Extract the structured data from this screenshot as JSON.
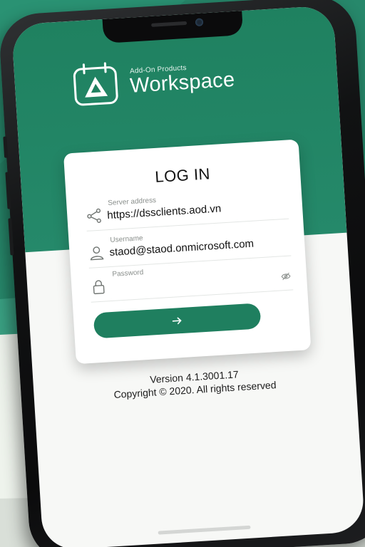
{
  "app": {
    "brand_subtitle": "Add-On Products",
    "brand_title": "Workspace",
    "logo_icon": "calendar-a-icon"
  },
  "login": {
    "title": "LOG IN",
    "server": {
      "label": "Server address",
      "value": "https://dssclients.aod.vn",
      "icon": "share-nodes-icon"
    },
    "username": {
      "label": "Username",
      "value": "staod@staod.onmicrosoft.com",
      "icon": "user-icon"
    },
    "password": {
      "label": "Password",
      "value": "",
      "icon": "lock-icon",
      "toggle_icon": "eye-off-icon"
    },
    "submit_icon": "arrow-right-icon"
  },
  "footer": {
    "version": "Version 4.1.3001.17",
    "copyright": "Copyright © 2020. All rights reserved"
  },
  "colors": {
    "brand_green": "#1f7f5f",
    "background_green": "#2b8f72",
    "screen_background": "#f7f8f6"
  }
}
